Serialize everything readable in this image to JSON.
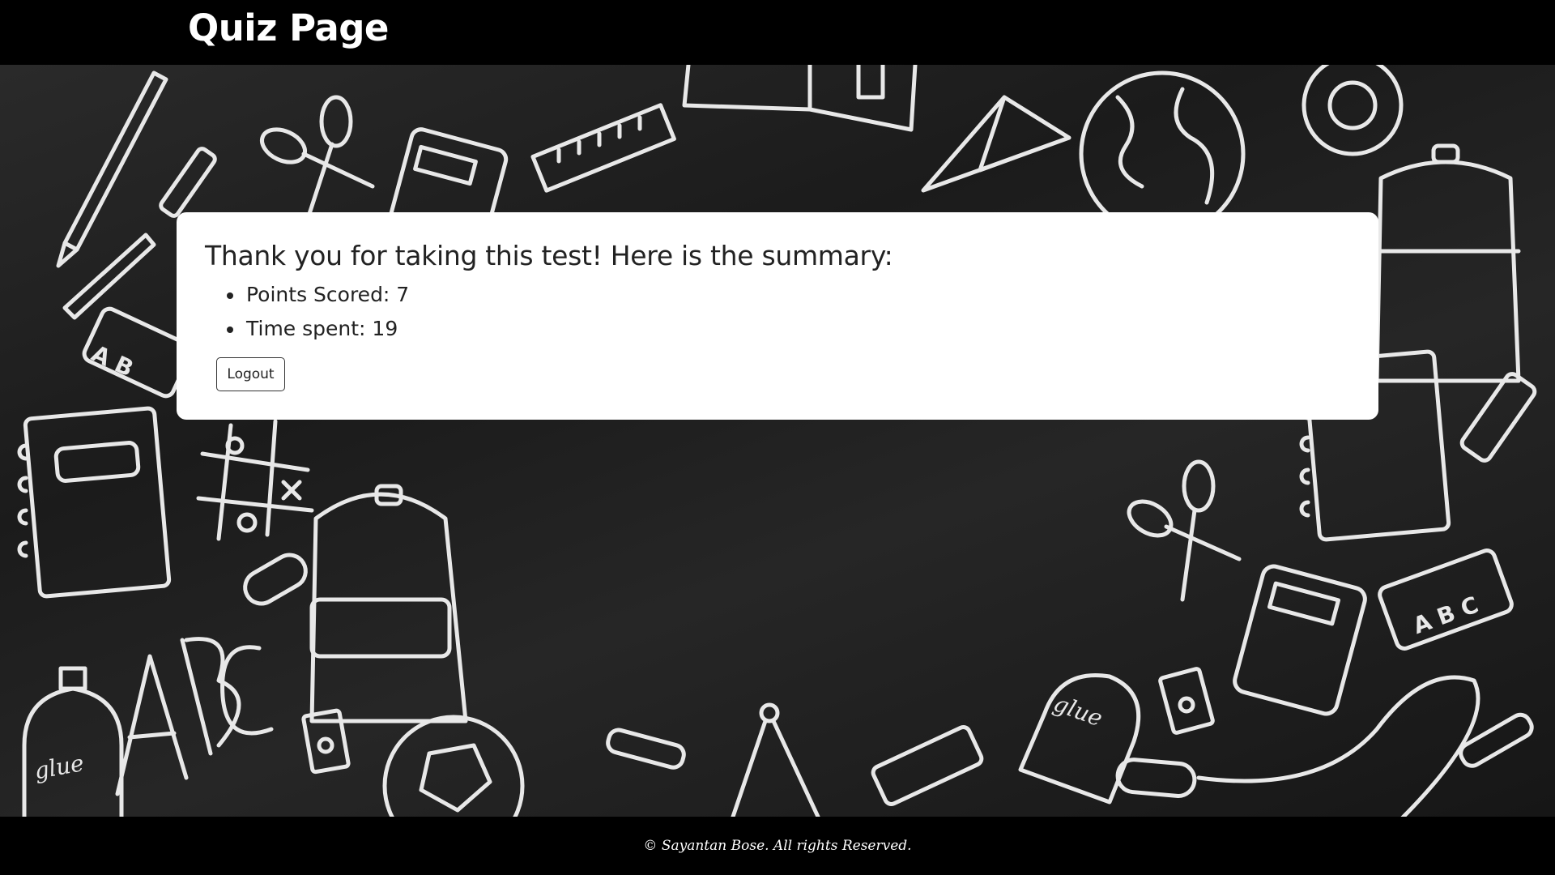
{
  "header": {
    "title": "Quiz Page"
  },
  "summary": {
    "heading": "Thank you for taking this test! Here is the summary:",
    "items": [
      {
        "text": "Points Scored: 7"
      },
      {
        "text": "Time spent: 19"
      }
    ],
    "logout_label": "Logout"
  },
  "footer": {
    "text": "© Sayantan Bose. All rights Reserved."
  },
  "colors": {
    "header_bg": "#000000",
    "board_bg": "#1f1f1f",
    "card_bg": "#ffffff",
    "text": "#222222"
  },
  "background": {
    "icons": [
      "pencil-icon",
      "scissors-icon",
      "calculator-icon",
      "ruler-icon",
      "book-icon",
      "paper-plane-icon",
      "globe-icon",
      "tape-icon",
      "backpack-icon",
      "notebook-icon",
      "glue-icon",
      "ball-icon",
      "compass-icon",
      "eraser-icon",
      "sharpener-icon",
      "crayon-icon",
      "tic-tac-toe-icon"
    ],
    "lettering": [
      "ABC",
      "glue"
    ]
  }
}
